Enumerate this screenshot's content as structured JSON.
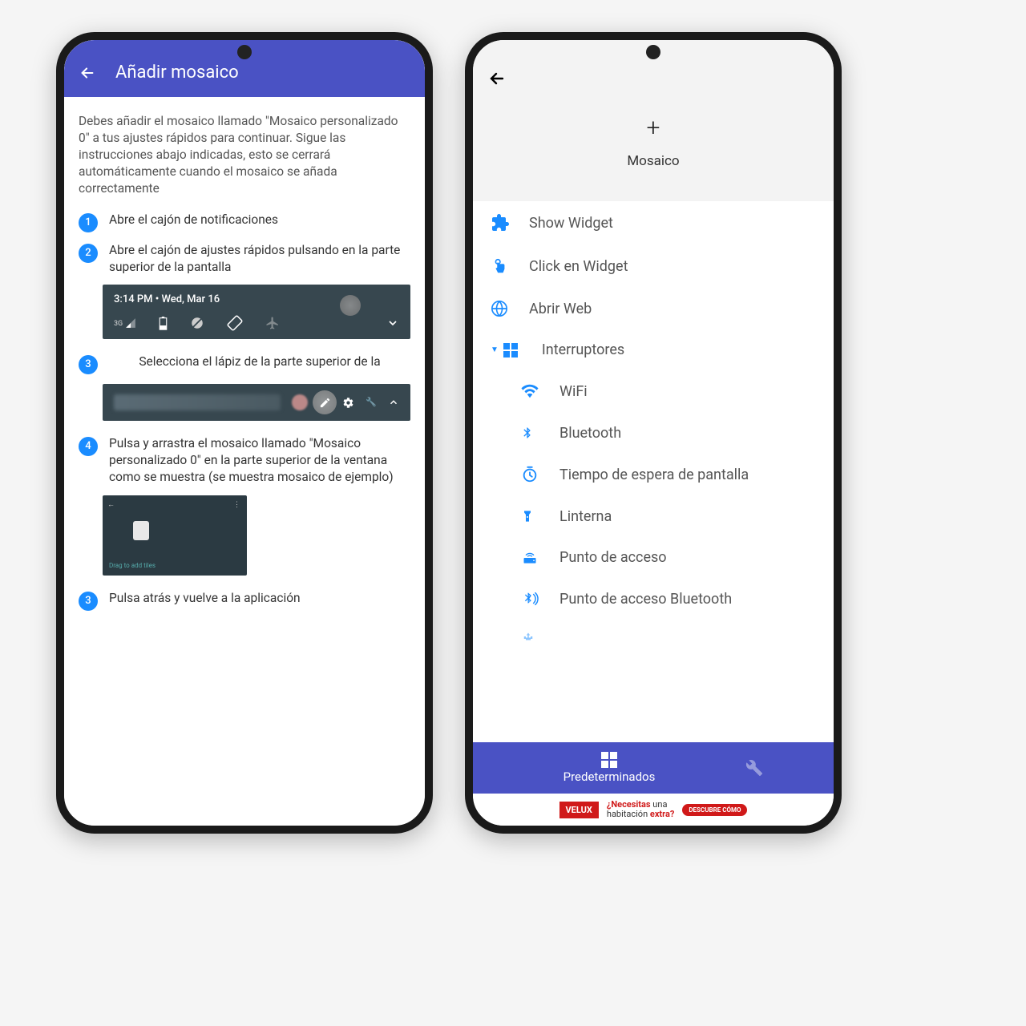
{
  "left": {
    "title": "Añadir mosaico",
    "description": "Debes añadir el mosaico llamado \"Mosaico personalizado 0\" a tus ajustes rápidos para continuar. Sigue las instrucciones abajo indicadas, esto se cerrará automáticamente cuando el mosaico se añada correctamente",
    "steps": {
      "s1": "Abre el cajón de notificaciones",
      "s2": "Abre el cajón de ajustes rápidos pulsando en la parte superior de la pantalla",
      "s3": "Selecciona el lápiz de la parte superior de la",
      "s4": "Pulsa y arrastra el mosaico llamado \"Mosaico personalizado 0\" en la parte superior de la ventana como se muestra (se muestra mosaico de ejemplo)",
      "s5": "Pulsa atrás y vuelve a la aplicación"
    },
    "step_nums": {
      "n1": "1",
      "n2": "2",
      "n3": "3",
      "n4": "4",
      "n5": "3"
    },
    "demo": {
      "time": "3:14 PM  •  Wed, Mar 16",
      "sig": "3G",
      "drag": "Drag to add tiles"
    }
  },
  "right": {
    "hero_label": "Mosaico",
    "items": {
      "show_widget": "Show Widget",
      "click_widget": "Click en Widget",
      "open_web": "Abrir Web",
      "switches": "Interruptores",
      "wifi": "WiFi",
      "bluetooth": "Bluetooth",
      "screen_timeout": "Tiempo de espera de pantalla",
      "flashlight": "Linterna",
      "hotspot": "Punto de acceso",
      "bt_hotspot": "Punto de acceso Bluetooth"
    },
    "bottom": {
      "defaults": "Predeterminados"
    },
    "ad": {
      "brand": "VELUX",
      "line1": "¿Necesitas",
      "line1b": " una",
      "line2": "habitación",
      "line2b": " extra?",
      "cta": "DESCUBRE CÓMO"
    }
  }
}
